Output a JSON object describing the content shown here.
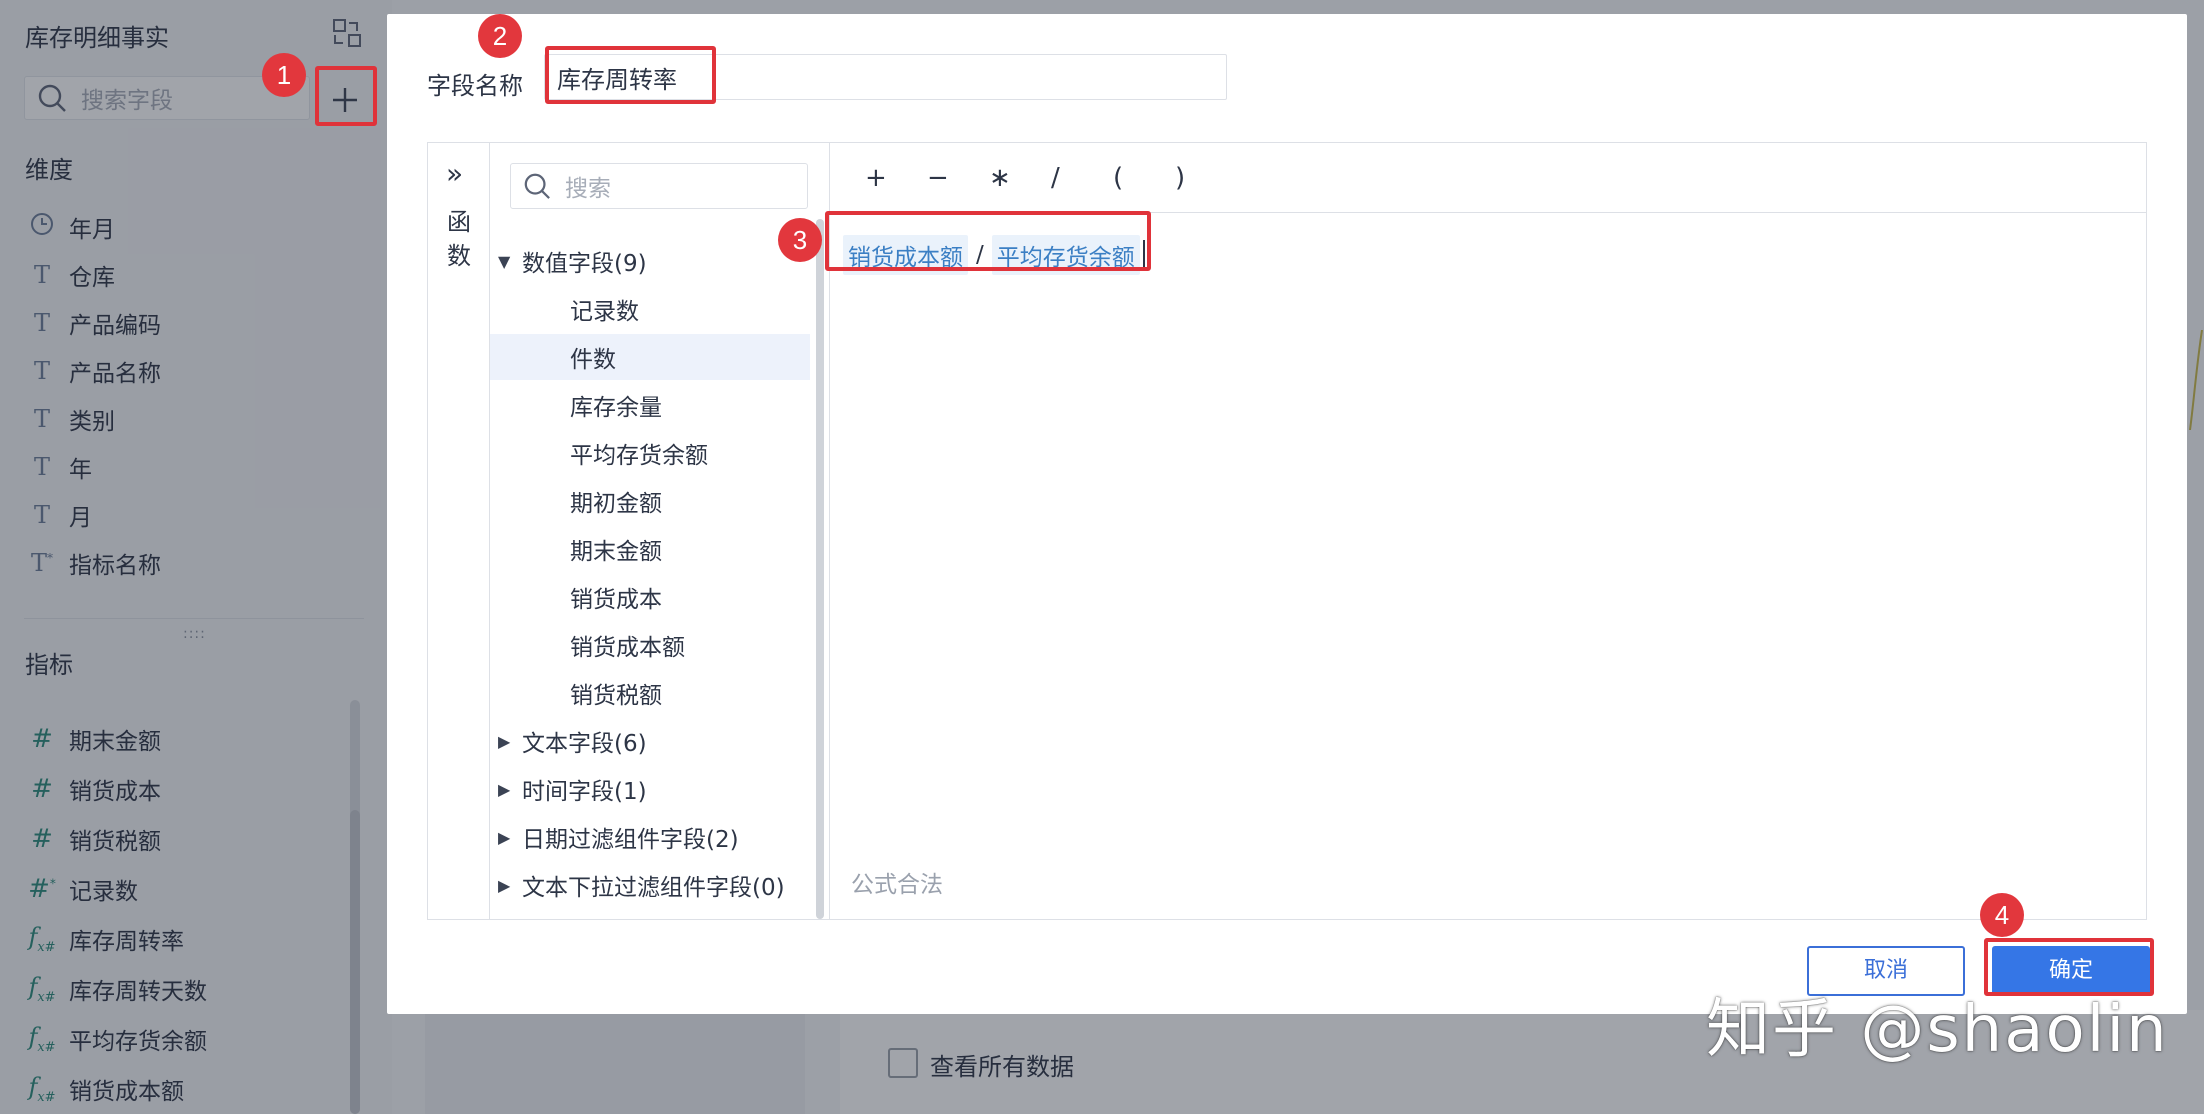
{
  "left_panel": {
    "title": "库存明细事实",
    "search_placeholder": "搜索字段",
    "dimensions_heading": "维度",
    "dimensions": [
      {
        "label": "年月",
        "icon": "clock-icon"
      },
      {
        "label": "仓库",
        "icon": "text-field-icon"
      },
      {
        "label": "产品编码",
        "icon": "text-field-icon"
      },
      {
        "label": "产品名称",
        "icon": "text-field-icon"
      },
      {
        "label": "类别",
        "icon": "text-field-icon"
      },
      {
        "label": "年",
        "icon": "text-field-icon"
      },
      {
        "label": "月",
        "icon": "text-field-icon"
      },
      {
        "label": "指标名称",
        "icon": "text-field-calc-icon"
      }
    ],
    "drag_handle": "::::",
    "measures_heading": "指标",
    "measures": [
      {
        "label": "期末金额",
        "icon": "number-field-icon"
      },
      {
        "label": "销货成本",
        "icon": "number-field-icon"
      },
      {
        "label": "销货税额",
        "icon": "number-field-icon"
      },
      {
        "label": "记录数",
        "icon": "number-field-calc-icon"
      },
      {
        "label": "库存周转率",
        "icon": "formula-field-icon"
      },
      {
        "label": "库存周转天数",
        "icon": "formula-field-icon"
      },
      {
        "label": "平均存货余额",
        "icon": "formula-field-icon"
      },
      {
        "label": "销货成本额",
        "icon": "formula-field-icon"
      }
    ]
  },
  "background": {
    "checkbox_label": "查看所有数据"
  },
  "dialog": {
    "name_label": "字段名称",
    "name_value": "库存周转率",
    "functions_label": "函数",
    "tree_search_placeholder": "搜索",
    "tree": {
      "numeric_group": "数值字段(9)",
      "numeric_fields": [
        "记录数",
        "件数",
        "库存余量",
        "平均存货余额",
        "期初金额",
        "期末金额",
        "销货成本",
        "销货成本额",
        "销货税额"
      ],
      "selected_field": "件数",
      "collapsed_groups": [
        "文本字段(6)",
        "时间字段(1)",
        "日期过滤组件字段(2)",
        "文本下拉过滤组件字段(0)"
      ]
    },
    "operators": [
      "+",
      "−",
      "∗",
      "/",
      "(",
      ")"
    ],
    "formula": {
      "token_a": "销货成本额",
      "operator": "/",
      "token_b": "平均存货余额"
    },
    "formula_status": "公式合法",
    "cancel_label": "取消",
    "confirm_label": "确定"
  },
  "annotations": [
    "1",
    "2",
    "3",
    "4"
  ],
  "watermark": "知乎 @shaolin",
  "colors": {
    "primary_button": "#3576e6",
    "highlight_box": "#e0333a",
    "formula_token": "#3b7fc4",
    "measure_icon": "#2a8a7a"
  }
}
